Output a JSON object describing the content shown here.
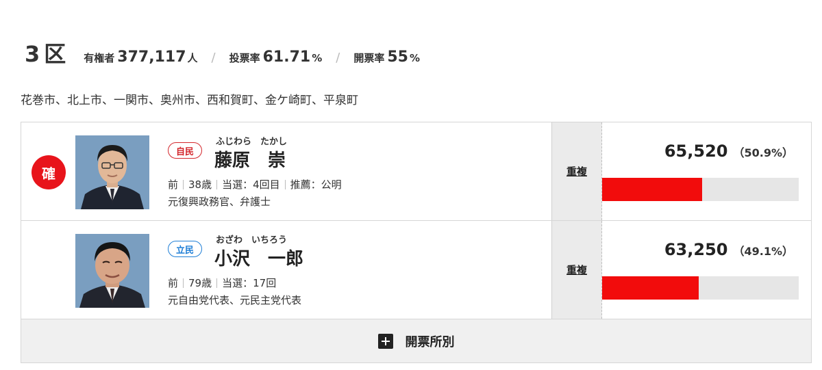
{
  "district": {
    "name": "3区",
    "electorate_label": "有権者",
    "electorate_value": "377,117",
    "electorate_unit": "人",
    "turnout_label": "投票率",
    "turnout_value": "61.71",
    "turnout_unit": "%",
    "counted_label": "開票率",
    "counted_value": "55",
    "counted_unit": "%",
    "separator": "/"
  },
  "areas": "花巻市、北上市、一関市、奥州市、西和賀町、金ケ崎町、平泉町",
  "candidates": [
    {
      "elected_mark": "確",
      "party": "自民",
      "party_color": "#d3262b",
      "kana": "ふじわら　たかし",
      "name": "藤原　崇",
      "status": "前",
      "age": "38歳",
      "wins": "当選：4回目",
      "endorsement": "推薦：公明",
      "career": "元復興政務官、弁護士",
      "duplicate": "重複",
      "votes": "65,520",
      "percent": "（50.9%）",
      "share": 0.509
    },
    {
      "elected_mark": "",
      "party": "立民",
      "party_color": "#1e7ed6",
      "kana": "おざわ　いちろう",
      "name": "小沢　一郎",
      "status": "前",
      "age": "79歳",
      "wins": "当選：17回",
      "endorsement": "",
      "career": "元自由党代表、元民主党代表",
      "duplicate": "重複",
      "votes": "63,250",
      "percent": "（49.1%）",
      "share": 0.491
    }
  ],
  "footer": {
    "label": "開票所別",
    "icon": "plus-square-icon"
  },
  "colors": {
    "bar_fill": "#f20c0c",
    "bar_track": "#e6e6e6",
    "elected_badge": "#e8141b"
  }
}
